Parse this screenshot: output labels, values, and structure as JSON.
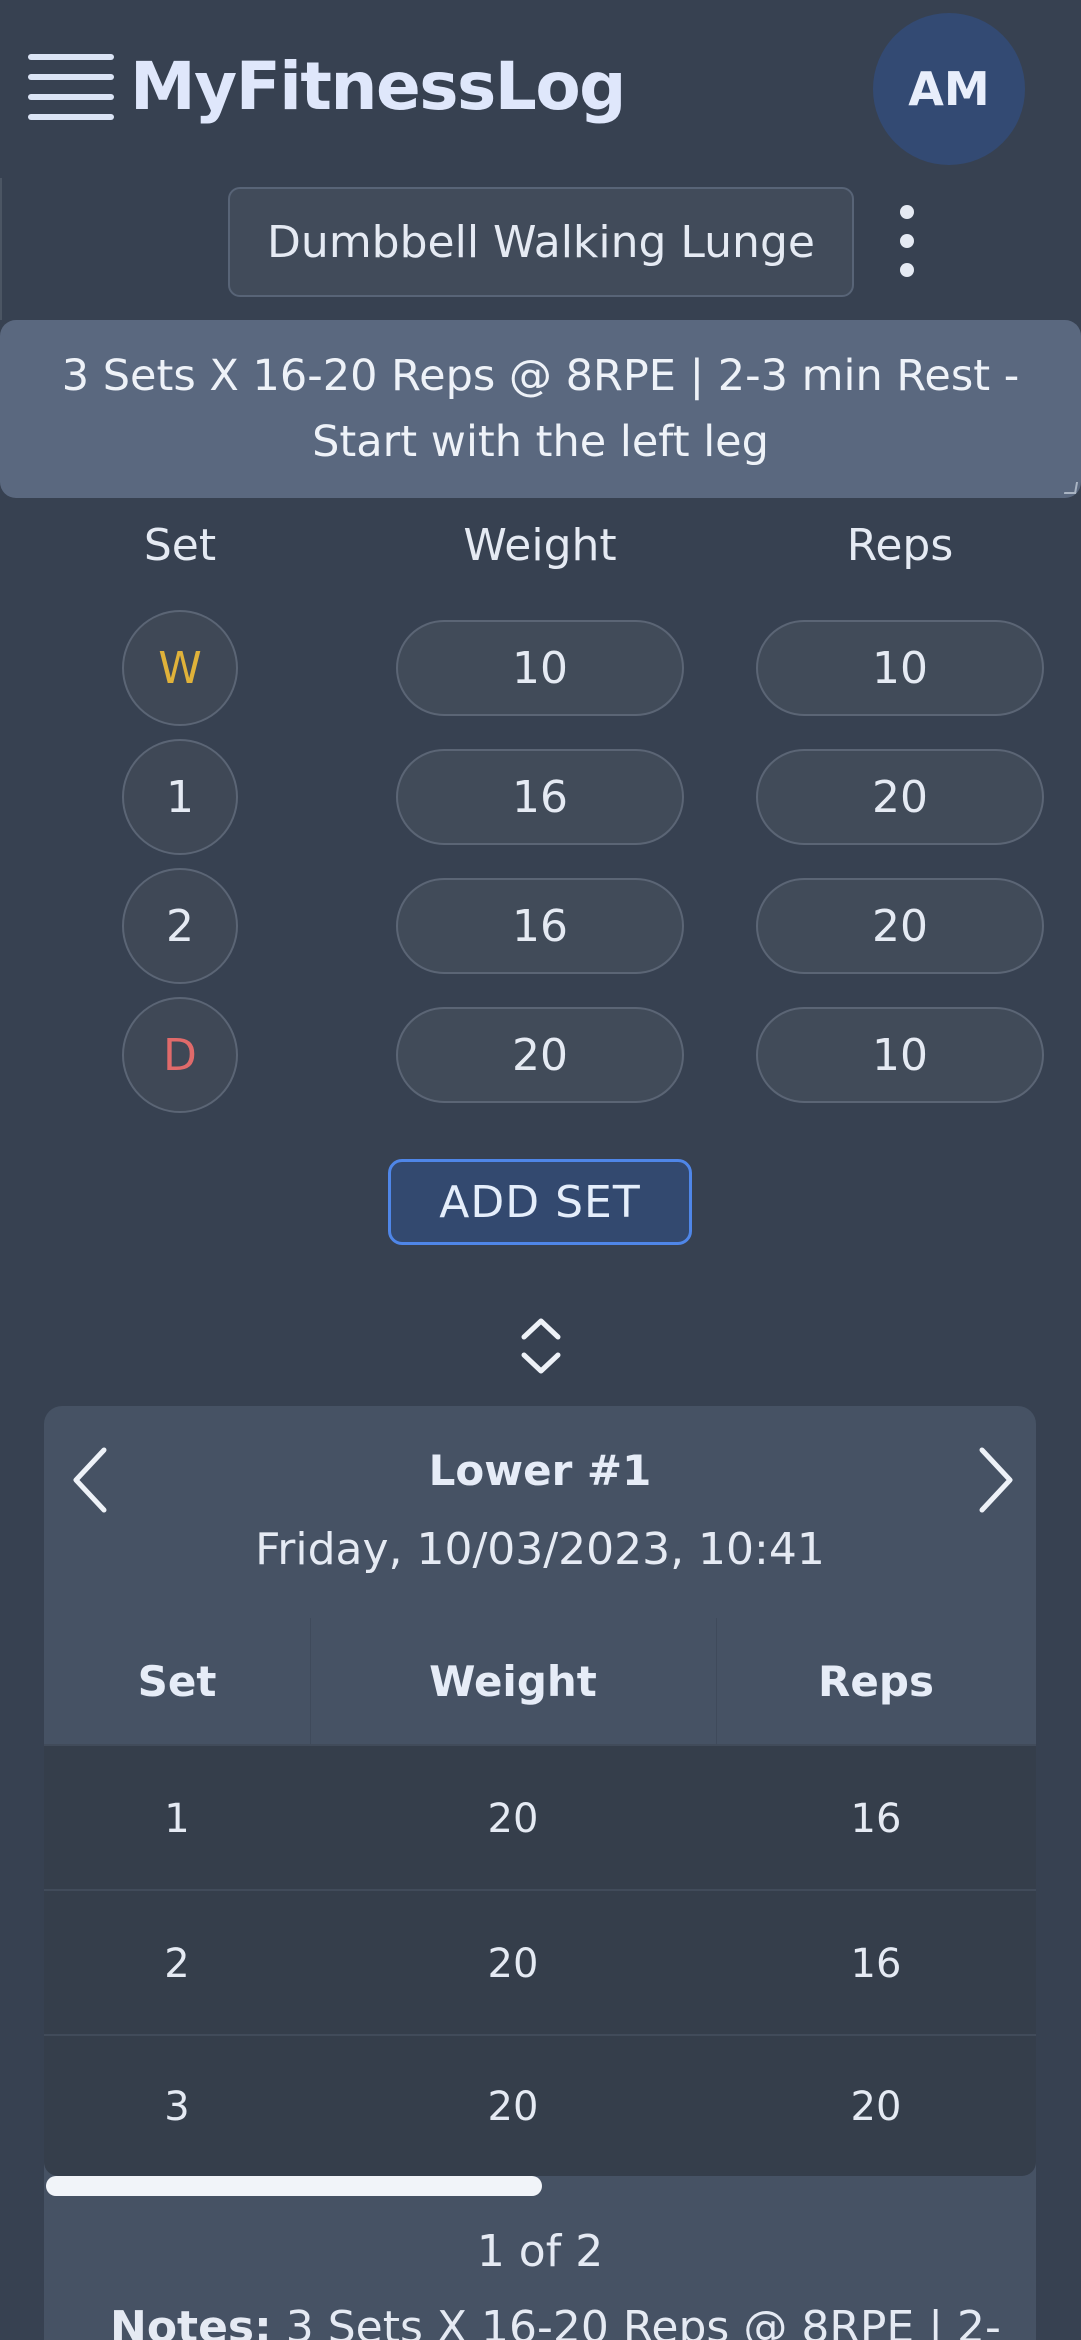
{
  "app": {
    "title": "MyFitnessLog",
    "avatar_initials": "AM"
  },
  "exercise": {
    "name": "Dumbbell Walking Lunge",
    "instructions": "3 Sets X 16-20 Reps @ 8RPE | 2-3 min Rest - Start with the left leg"
  },
  "sets_table": {
    "headers": {
      "set": "Set",
      "weight": "Weight",
      "reps": "Reps"
    },
    "rows": [
      {
        "set": "W",
        "weight": "10",
        "reps": "10",
        "set_color": "#e0b23a"
      },
      {
        "set": "1",
        "weight": "16",
        "reps": "20",
        "set_color": "#e5eaf3"
      },
      {
        "set": "2",
        "weight": "16",
        "reps": "20",
        "set_color": "#e5eaf3"
      },
      {
        "set": "D",
        "weight": "20",
        "reps": "10",
        "set_color": "#e06a6a"
      }
    ],
    "add_set_label": "ADD SET"
  },
  "history": {
    "title": "Lower #1",
    "date": "Friday, 10/03/2023, 10:41",
    "headers": {
      "set": "Set",
      "weight": "Weight",
      "reps": "Reps"
    },
    "rows": [
      {
        "set": "1",
        "weight": "20",
        "reps": "16"
      },
      {
        "set": "2",
        "weight": "20",
        "reps": "16"
      },
      {
        "set": "3",
        "weight": "20",
        "reps": "20"
      }
    ],
    "pager": "1 of 2",
    "notes_label": "Notes:",
    "notes_text": "3 Sets X 16-20 Reps @ 8RPE | 2-"
  },
  "icons": {
    "menu": "hamburger-menu-icon",
    "more": "kebab-more-icon",
    "expand": "expand-collapse-icon",
    "prev": "chevron-left-icon",
    "next": "chevron-right-icon"
  },
  "colors": {
    "background": "#374151",
    "banner": "#5a687f",
    "accent": "#4f86e8",
    "warmup": "#e0b23a",
    "drop": "#e06a6a"
  }
}
